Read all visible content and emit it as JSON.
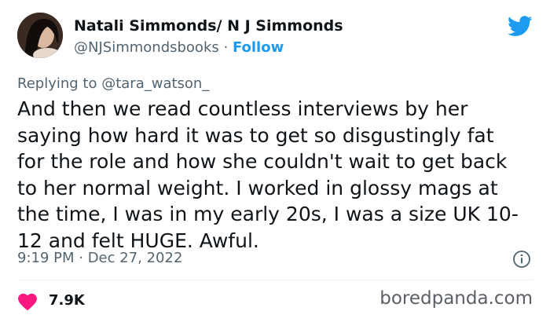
{
  "tweet": {
    "display_name": "Natali Simmonds/ N J Simmonds",
    "handle": "@NJSimmondsbooks",
    "separator": "·",
    "follow_label": "Follow",
    "reply_prefix": "Replying to ",
    "reply_to": "@tara_watson_",
    "lines": [
      "And then we read countless interviews by her",
      "saying how hard it was to get so disgustingly fat",
      "for the role and how she couldn't wait to get back",
      "to her normal weight. I worked in glossy mags at",
      "the time, I was in my early 20s, I was a size UK 10-",
      "12 and felt HUGE. Awful."
    ],
    "timestamp": "9:19 PM · Dec 27, 2022",
    "like_count": "7.9K"
  },
  "watermark": "boredpanda.com",
  "icons": {
    "brand": "twitter-bird-icon",
    "info": "info-icon",
    "like": "heart-icon"
  },
  "colors": {
    "accent": "#1d9bf0",
    "heart": "#f91880",
    "muted_text": "#536471",
    "main_text": "#0f1419"
  }
}
